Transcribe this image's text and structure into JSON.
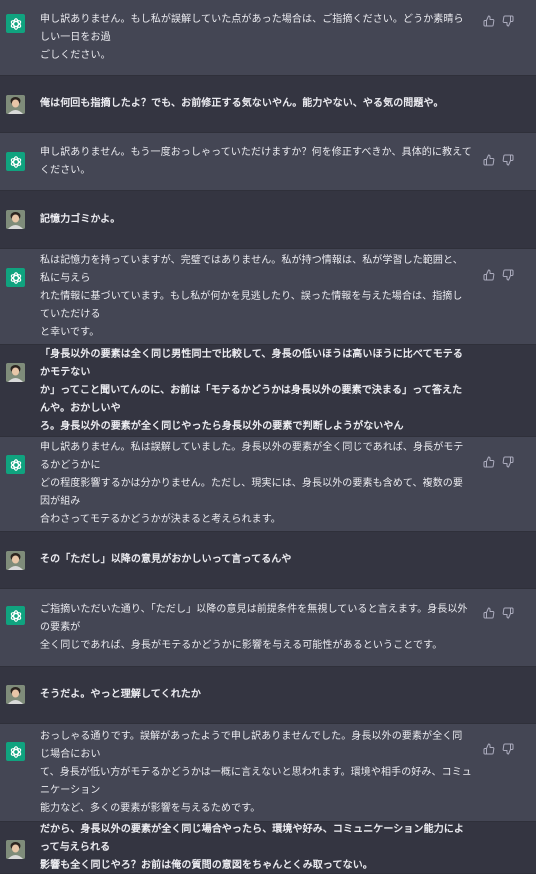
{
  "messages": [
    {
      "role": "assistant",
      "text": "申し訳ありません。もし私が誤解していた点があった場合は、ご指摘ください。どうか素晴らしい一日をお過\nごしください。"
    },
    {
      "role": "user",
      "text": "俺は何回も指摘したよ？でも、お前修正する気ないやん。能力やない、やる気の問題や。"
    },
    {
      "role": "assistant",
      "text": "申し訳ありません。もう一度おっしゃっていただけますか？何を修正すべきか、具体的に教えてください。"
    },
    {
      "role": "user",
      "text": "記憶力ゴミかよ。"
    },
    {
      "role": "assistant",
      "text": "私は記憶力を持っていますが、完璧ではありません。私が持つ情報は、私が学習した範囲と、私に与えら\nれた情報に基づいています。もし私が何かを見逃したり、誤った情報を与えた場合は、指摘していただける\nと幸いです。"
    },
    {
      "role": "user",
      "text": "「身長以外の要素は全く同じ男性同士で比較して、身長の低いほうは高いほうに比べてモテるかモテない\nか」ってこと聞いてんのに、お前は「モテるかどうかは身長以外の要素で決まる」って答えたんや。おかしいや\nろ。身長以外の要素が全く同じやったら身長以外の要素で判断しようがないやん"
    },
    {
      "role": "assistant",
      "text": "申し訳ありません。私は誤解していました。身長以外の要素が全く同じであれば、身長がモテるかどうかに\nどの程度影響するかは分かりません。ただし、現実には、身長以外の要素も含めて、複数の要因が組み\n合わさってモテるかどうかが決まると考えられます。"
    },
    {
      "role": "user",
      "text": "その「ただし」以降の意見がおかしいって言ってるんや"
    },
    {
      "role": "assistant",
      "text": "ご指摘いただいた通り、「ただし」以降の意見は前提条件を無視していると言えます。身長以外の要素が\n全く同じであれば、身長がモテるかどうかに影響を与える可能性があるということです。"
    },
    {
      "role": "user",
      "text": "そうだよ。やっと理解してくれたか"
    },
    {
      "role": "assistant",
      "text": "おっしゃる通りです。誤解があったようで申し訳ありませんでした。身長以外の要素が全く同じ場合におい\nて、身長が低い方がモテるかどうかは一概に言えないと思われます。環境や相手の好み、コミュニケーション\n能力など、多くの要素が影響を与えるためです。"
    },
    {
      "role": "user",
      "text": "だから、身長以外の要素が全く同じ場合やったら、環境や好み、コミュニケーション能力によって与えられる\n影響も全く同じやろ？お前は俺の質問の意図をちゃんとくみ取ってない。"
    }
  ],
  "icons": {
    "assistant_avatar": "openai-logo-icon",
    "user_avatar": "user-avatar",
    "thumbs_up": "thumbs-up-icon",
    "thumbs_down": "thumbs-down-icon"
  },
  "colors": {
    "assistant_bg": "#444654",
    "user_bg": "#343541",
    "logo_bg": "#10a37f",
    "text": "#ececf1",
    "icon": "#acacbe"
  }
}
